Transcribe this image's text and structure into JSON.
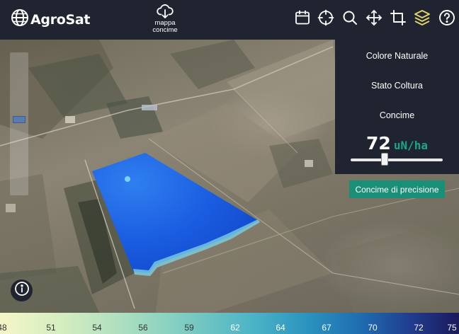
{
  "app": {
    "title": "AgroSat",
    "logo_icon": "globe-icon"
  },
  "toolbar": {
    "map_export": {
      "label_line1": "mappa",
      "label_line2": "concime",
      "icon": "cloud-download-icon"
    },
    "tools": [
      {
        "name": "calendar-icon"
      },
      {
        "name": "crosshair-icon"
      },
      {
        "name": "search-icon"
      },
      {
        "name": "move-icon"
      },
      {
        "name": "crop-icon"
      },
      {
        "name": "layers-icon",
        "color": "#e3d36b"
      },
      {
        "name": "help-icon"
      }
    ]
  },
  "panel": {
    "items": [
      "Colore Naturale",
      "Stato Coltura",
      "Concime"
    ],
    "dose_value": "72",
    "dose_unit": "uN/ha",
    "slider_fraction": 0.37,
    "precision_button": "Concime di precisione",
    "accent_color": "#1a8f77"
  },
  "zoom": {
    "level_fraction": 0.47
  },
  "legend": {
    "labels": [
      "48",
      "51",
      "54",
      "56",
      "59",
      "62",
      "64",
      "67",
      "70",
      "72",
      "75"
    ],
    "label_colors": [
      "#333333",
      "#333333",
      "#333333",
      "#333333",
      "#333333",
      "#ffffff",
      "#ffffff",
      "#ffffff",
      "#ffffff",
      "#ffffff",
      "#ffffff"
    ]
  }
}
